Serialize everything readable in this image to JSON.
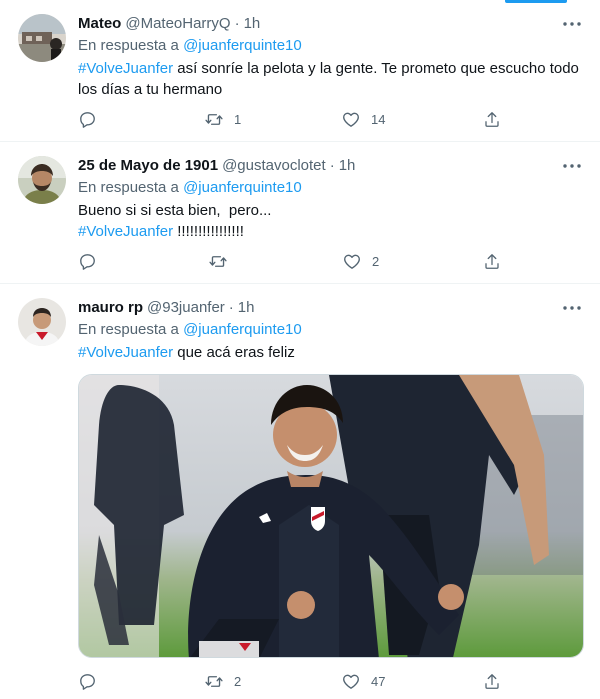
{
  "tweets": [
    {
      "name": "Mateo",
      "handle": "@MateoHarryQ",
      "separator": "·",
      "time": "1h",
      "reply_prefix": "En respuesta a",
      "reply_to": "@juanferquinte10",
      "hashtag": "#VolveJuanfer",
      "text_rest": " así sonríe la pelota y la gente. Te prometo que escucho todo los días a tu hermano",
      "replies": "",
      "retweets": "1",
      "likes": "14"
    },
    {
      "name": "25 de Mayo de 1901",
      "handle": "@gustavoclotet",
      "separator": "·",
      "time": "1h",
      "reply_prefix": "En respuesta a",
      "reply_to": "@juanferquinte10",
      "line1": "Bueno si si esta bien,  pero...",
      "hashtag": "#VolveJuanfer",
      "text_rest": " !!!!!!!!!!!!!!!!",
      "replies": "",
      "retweets": "",
      "likes": "2"
    },
    {
      "name": "mauro rp",
      "handle": "@93juanfer",
      "separator": "·",
      "time": "1h",
      "reply_prefix": "En respuesta a",
      "reply_to": "@juanferquinte10",
      "hashtag": "#VolveJuanfer",
      "text_rest": " que acá eras feliz",
      "replies": "",
      "retweets": "2",
      "likes": "47"
    }
  ],
  "icons": {
    "more": "more-icon",
    "reply": "reply-icon",
    "retweet": "retweet-icon",
    "like": "heart-icon",
    "share": "share-icon"
  },
  "colors": {
    "link": "#1d9bf0",
    "secondary_text": "#536471",
    "primary_text": "#0f1419",
    "divider": "#eff3f4"
  }
}
